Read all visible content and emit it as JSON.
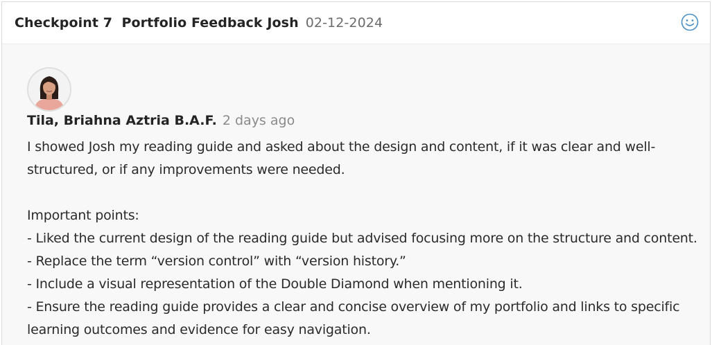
{
  "header": {
    "title": "Checkpoint 7  Portfolio Feedback Josh",
    "date": "02-12-2024",
    "reaction_icon": "smiley-icon"
  },
  "comment": {
    "author": "Tila, Briahna Aztria B.A.F.",
    "time_ago": "2 days ago",
    "paragraph1": "I showed Josh my reading guide and asked about the design and content, if it was clear and well-structured, or if any improvements were needed.",
    "points_heading": "Important points:",
    "points": [
      "- Liked the current design of the reading guide but advised focusing more on the structure and content.",
      "- Replace the term “version control” with “version history.”",
      "- Include a visual representation of the Double Diamond when mentioning it.",
      "- Ensure the reading guide provides a clear and concise overview of my portfolio and links to specific learning outcomes and evidence for easy navigation."
    ]
  },
  "colors": {
    "header_bg": "#ffffff",
    "content_bg": "#f8f8f8",
    "accent_icon": "#4a90c8",
    "muted_text": "#8a8a8a"
  }
}
